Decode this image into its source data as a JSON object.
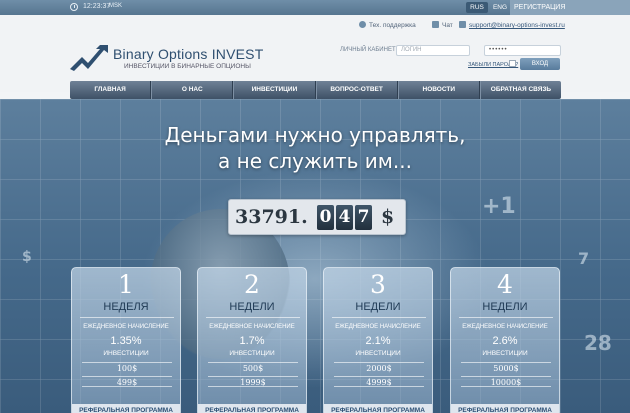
{
  "topbar": {
    "time": "12:23:37",
    "timezone": "MSK",
    "languages": [
      "RUS",
      "ENG"
    ],
    "register_label": "РЕГИСТРАЦИЯ"
  },
  "contacts": {
    "support": "Тех. поддержка",
    "chat": "Чат",
    "email": "support@binary-options-invest.ru"
  },
  "logo": {
    "title": "Binary Options INVEST",
    "subtitle": "ИНВЕСТИЦИИ В БИНАРНЫЕ ОПЦИОНЫ"
  },
  "login": {
    "label": "ЛИЧНЫЙ КАБИНЕТ",
    "login_placeholder": "ЛОГИН",
    "password_value": "••••••",
    "forgot": "ЗАБЫЛИ ПАРОЛЬ?",
    "button": "ВХОД"
  },
  "nav": [
    "ГЛАВНАЯ",
    "О НАС",
    "ИНВЕСТИЦИИ",
    "ВОПРОС-ОТВЕТ",
    "НОВОСТИ",
    "ОБРАТНАЯ СВЯЗЬ"
  ],
  "hero": {
    "headline_1": "Деньгами нужно управлять,",
    "headline_2": "а не служить им...",
    "deco": [
      "+1",
      "7",
      "28",
      "$"
    ]
  },
  "counter": {
    "integer": "33791.",
    "digits": [
      "0",
      "4",
      "7"
    ],
    "currency": "$"
  },
  "plans": [
    {
      "num": "1",
      "period": "НЕДЕЛЯ",
      "daily": "ЕЖЕДНЕВНОЕ НАЧИСЛЕНИЕ",
      "rate": "1.35%",
      "inv": "ИНВЕСТИЦИИ",
      "min": "100$",
      "max": "499$",
      "ref": "РЕФЕРАЛЬНАЯ ПРОГРАММА"
    },
    {
      "num": "2",
      "period": "НЕДЕЛИ",
      "daily": "ЕЖЕДНЕВНОЕ НАЧИСЛЕНИЕ",
      "rate": "1.7%",
      "inv": "ИНВЕСТИЦИИ",
      "min": "500$",
      "max": "1999$",
      "ref": "РЕФЕРАЛЬНАЯ ПРОГРАММА"
    },
    {
      "num": "3",
      "period": "НЕДЕЛИ",
      "daily": "ЕЖЕДНЕВНОЕ НАЧИСЛЕНИЕ",
      "rate": "2.1%",
      "inv": "ИНВЕСТИЦИИ",
      "min": "2000$",
      "max": "4999$",
      "ref": "РЕФЕРАЛЬНАЯ ПРОГРАММА"
    },
    {
      "num": "4",
      "period": "НЕДЕЛИ",
      "daily": "ЕЖЕДНЕВНОЕ НАЧИСЛЕНИЕ",
      "rate": "2.6%",
      "inv": "ИНВЕСТИЦИИ",
      "min": "5000$",
      "max": "10000$",
      "ref": "РЕФЕРАЛЬНАЯ ПРОГРАММА"
    }
  ],
  "colors": {
    "brand": "#2f4f70",
    "topbar": "#56758f",
    "nav": "#3e5166"
  }
}
